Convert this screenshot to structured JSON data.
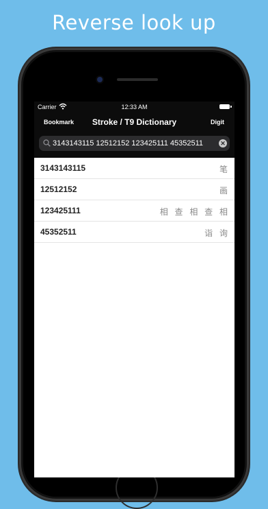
{
  "headline": "Reverse look up",
  "status_bar": {
    "carrier": "Carrier",
    "time": "12:33 AM"
  },
  "nav": {
    "left_button": "Bookmark",
    "title": "Stroke / T9 Dictionary",
    "right_button": "Digit"
  },
  "search": {
    "value": "3143143115 12512152 123425111 45352511",
    "clear_icon": "✕"
  },
  "results": [
    {
      "code": "3143143115",
      "chars": "笔"
    },
    {
      "code": "12512152",
      "chars": "画"
    },
    {
      "code": "123425111",
      "chars": "相 查 相 查 相"
    },
    {
      "code": "45352511",
      "chars": "诣 询"
    }
  ],
  "colors": {
    "background": "#6fbdea",
    "bar": "#0c0c0c",
    "search_field": "#2c2c2e"
  }
}
